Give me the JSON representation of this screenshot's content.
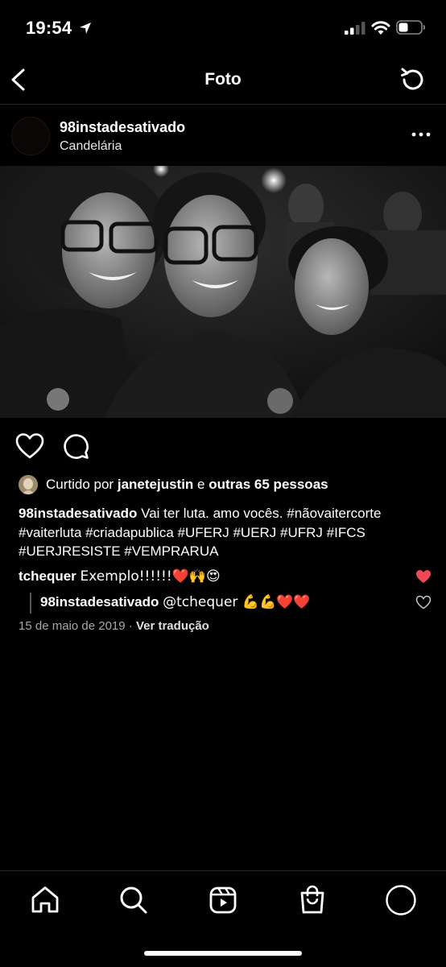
{
  "status_bar": {
    "time": "19:54"
  },
  "header": {
    "title": "Foto"
  },
  "post": {
    "username": "98instadesativado",
    "location": "Candelária",
    "likes": {
      "prefix": "Curtido por",
      "user": "janetejustin",
      "middle": "e",
      "others": "outras 65 pessoas"
    },
    "caption": {
      "username": "98instadesativado",
      "text": "Vai ter luta. amo vocês. #nãovaitercorte #vaiterluta #criadapublica #UFERJ #UERJ #UFRJ #IFCS #UERJRESISTE #VEMPRARUA"
    },
    "comments": [
      {
        "username": "tchequer",
        "text": "Exemplo!!!!!!❤️🙌😍",
        "liked": true
      },
      {
        "username": "98instadesativado",
        "text": "@tchequer 💪💪❤️❤️",
        "liked": false
      }
    ],
    "date": "15 de maio de 2019",
    "separator": "·",
    "translate_label": "Ver tradução"
  },
  "tabs": [
    "home-icon",
    "search-icon",
    "reels-icon",
    "shop-icon",
    "profile-icon"
  ],
  "colors": {
    "background": "#000000",
    "liked_heart": "#ed4956",
    "secondary_text": "#a8a8a8"
  }
}
